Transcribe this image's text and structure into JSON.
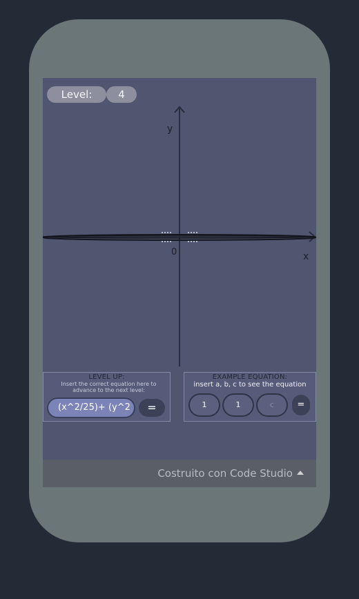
{
  "level": {
    "label": "Level:",
    "value": "4"
  },
  "graph": {
    "y_label": "y",
    "x_label": "x",
    "origin_label": "0"
  },
  "level_up": {
    "title": "LEVEL UP:",
    "instruction": "Insert the correct equation here to advance to the next level:",
    "input_value": "(x^2/25)+ (y^2",
    "submit_label": "="
  },
  "example_equation": {
    "title": "EXAMPLE EQUATION:",
    "instruction": "insert a, b, c to see the equation",
    "a_value": "1",
    "b_value": "1",
    "c_placeholder": "c",
    "submit_label": "="
  },
  "footer": {
    "text": "Costruito con Code Studio"
  },
  "colors": {
    "screen": "#505570",
    "accent": "#7c83b6",
    "phone": "#6b7679"
  }
}
